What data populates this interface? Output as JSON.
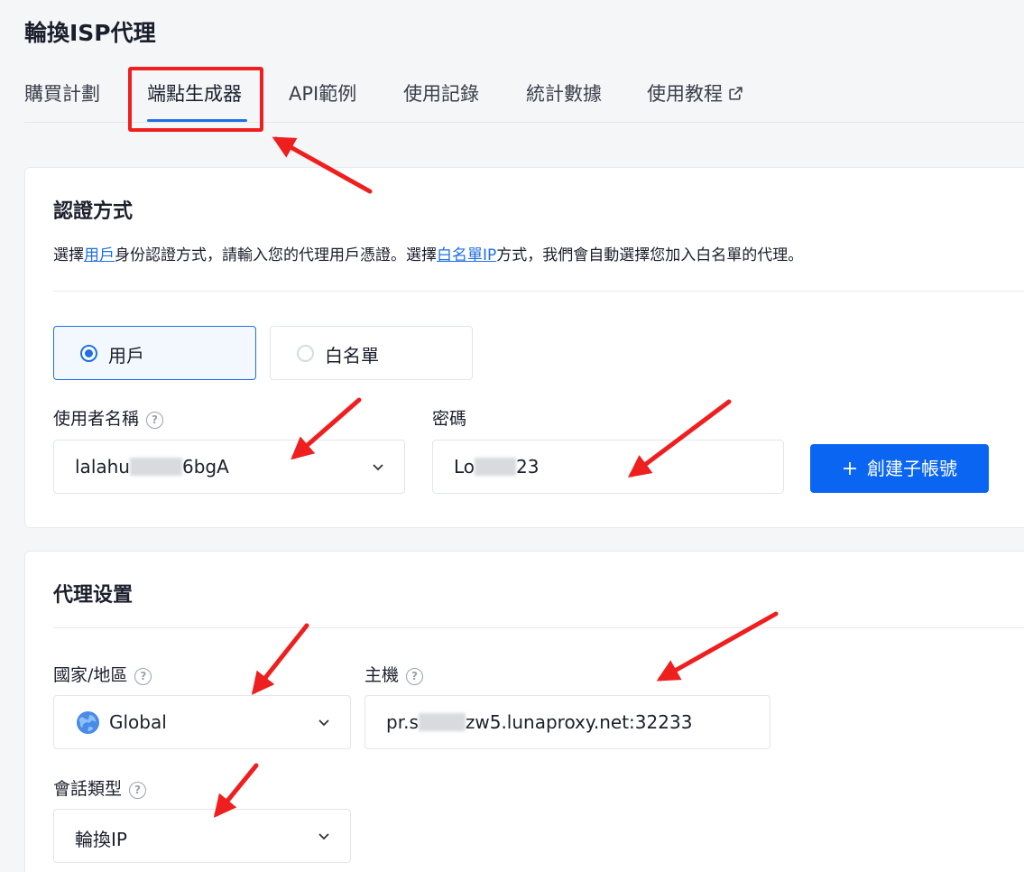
{
  "page": {
    "title": "輪換ISP代理"
  },
  "tabs": [
    {
      "label": "購買計劃"
    },
    {
      "label": "端點生成器"
    },
    {
      "label": "API範例"
    },
    {
      "label": "使用記錄"
    },
    {
      "label": "統計數據"
    },
    {
      "label": "使用教程"
    }
  ],
  "auth": {
    "title": "認證方式",
    "desc_part1": "選擇",
    "desc_link1": "用戶",
    "desc_part2": "身份認證方式，請輸入您的代理用戶憑證。選擇",
    "desc_link2": "白名單IP",
    "desc_part3": "方式，我們會自動選擇您加入白名單的代理。",
    "options": [
      {
        "label": "用戶",
        "selected": true
      },
      {
        "label": "白名單",
        "selected": false
      }
    ],
    "username_label": "使用者名稱",
    "username_prefix": "lalahu",
    "username_suffix": "6bgA",
    "password_label": "密碼",
    "password_prefix": "Lo",
    "password_suffix": "23",
    "create_button": "創建子帳號"
  },
  "proxy": {
    "title": "代理设置",
    "country_label": "國家/地區",
    "country_value": "Global",
    "host_label": "主機",
    "host_prefix": "pr.s",
    "host_suffix": "zw5.lunaproxy.net:32233",
    "session_label": "會話類型",
    "session_value": "輪換IP"
  },
  "colors": {
    "accent": "#1f6fe5",
    "button": "#0a66f2",
    "annotation": "#ef1f1f"
  },
  "icons": [
    "help-icon",
    "chevron-down-icon",
    "plus-icon",
    "globe-icon",
    "external-link-icon",
    "annotation-arrow"
  ]
}
